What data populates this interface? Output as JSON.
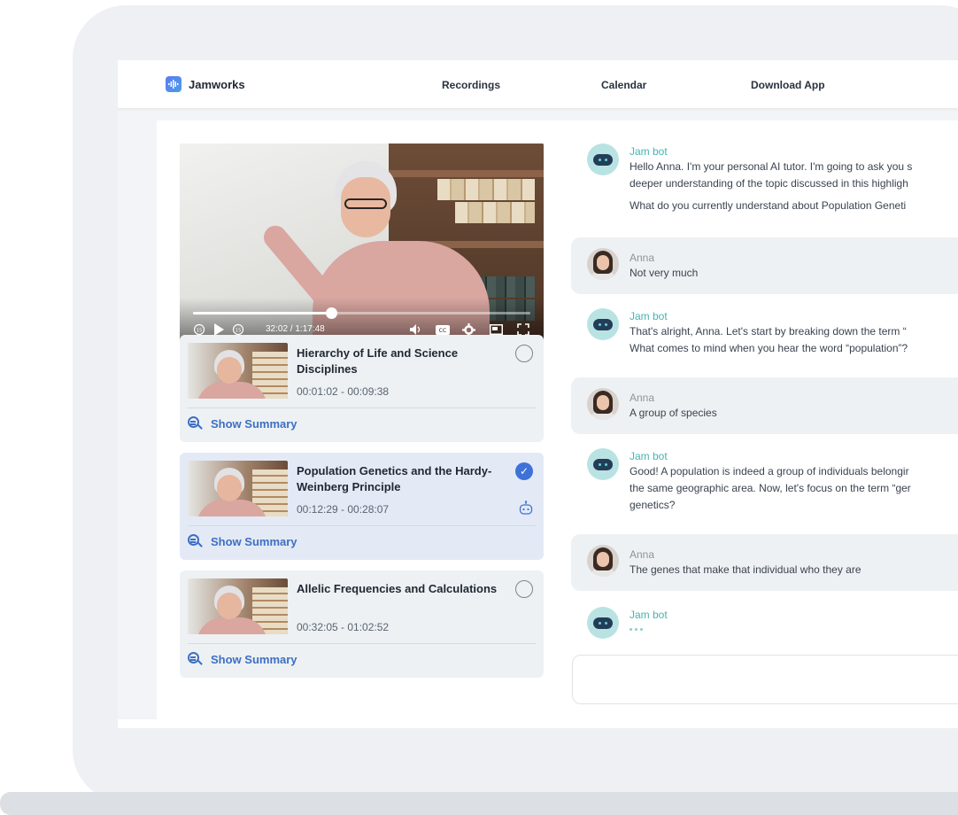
{
  "brand": {
    "name": "Jamworks",
    "logo": "waveform-logo-icon",
    "accent": "#5b7cf5"
  },
  "nav": {
    "items": [
      "Recordings",
      "Calendar",
      "Download App"
    ]
  },
  "player": {
    "time_readout": "32:02 / 1:17:48",
    "progress_fraction": 0.41,
    "controls": [
      "rewind-15-icon",
      "play-icon",
      "forward-15-icon",
      "volume-icon",
      "captions-icon",
      "settings-icon",
      "miniplayer-icon",
      "fullscreen-icon"
    ]
  },
  "segments": [
    {
      "title": "Hierarchy of Life and Science Disciplines",
      "time": "00:01:02 - 00:09:38",
      "completed": false,
      "active": false,
      "summary_label": "Show Summary"
    },
    {
      "title": "Population Genetics and the Hardy-Weinberg Principle",
      "time": "00:12:29 - 00:28:07",
      "completed": true,
      "active": true,
      "summary_label": "Show Summary"
    },
    {
      "title": "Allelic Frequencies and Calculations",
      "time": "00:32:05 - 01:02:52",
      "completed": false,
      "active": false,
      "summary_label": "Show Summary"
    }
  ],
  "chat": {
    "messages": [
      {
        "sender": "Jam bot",
        "role": "bot",
        "lines": [
          "Hello Anna. I'm your personal AI tutor. I'm going to ask you s",
          "deeper understanding of the topic discussed in this highligh",
          "What do you currently understand about Population Geneti"
        ]
      },
      {
        "sender": "Anna",
        "role": "user",
        "lines": [
          "Not very much"
        ]
      },
      {
        "sender": "Jam bot",
        "role": "bot",
        "lines": [
          "That's alright, Anna. Let's start by breaking down the term “",
          "What comes to mind when you hear the word “population”?"
        ]
      },
      {
        "sender": "Anna",
        "role": "user",
        "lines": [
          "A group of species"
        ]
      },
      {
        "sender": "Jam bot",
        "role": "bot",
        "lines": [
          "Good! A population is indeed a group of individuals belongir",
          "the same geographic area. Now, let's focus on the term “ger",
          "genetics?"
        ]
      },
      {
        "sender": "Anna",
        "role": "user",
        "lines": [
          "The genes that make that individual who they are"
        ]
      },
      {
        "sender": "Jam bot",
        "role": "bot",
        "lines": [],
        "typing": true
      }
    ],
    "input_placeholder": ""
  },
  "colors": {
    "bot_name": "#45b4b0",
    "link": "#3d6fc4",
    "check": "#3f72d8"
  }
}
